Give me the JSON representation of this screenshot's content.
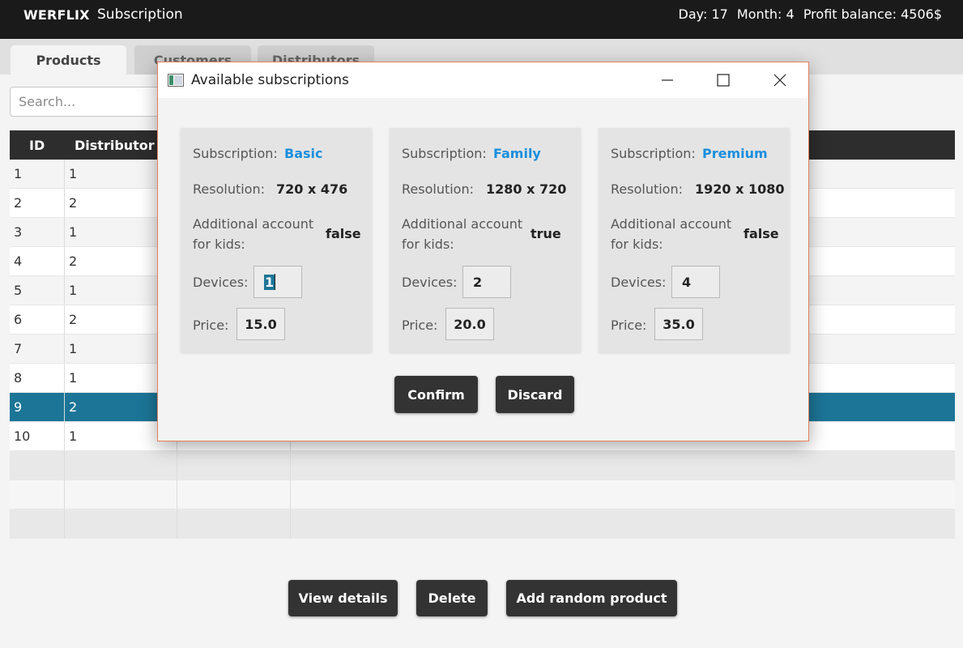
{
  "app": {
    "brand": "WERFLIX",
    "page": "Subscription",
    "stats": {
      "day": "Day: 17",
      "month": "Month: 4",
      "balance": "Profit balance: 4506$"
    }
  },
  "tabs": [
    "Products",
    "Customers",
    "Distributors"
  ],
  "search": {
    "placeholder": "Search...",
    "value": ""
  },
  "table": {
    "columns": [
      "ID",
      "Distributor I"
    ],
    "rows": [
      {
        "id": "1",
        "distributor": "1"
      },
      {
        "id": "2",
        "distributor": "2"
      },
      {
        "id": "3",
        "distributor": "1"
      },
      {
        "id": "4",
        "distributor": "2"
      },
      {
        "id": "5",
        "distributor": "1"
      },
      {
        "id": "6",
        "distributor": "2"
      },
      {
        "id": "7",
        "distributor": "1"
      },
      {
        "id": "8",
        "distributor": "1"
      },
      {
        "id": "9",
        "distributor": "2"
      },
      {
        "id": "10",
        "distributor": "1"
      }
    ],
    "selected_row": "9"
  },
  "buttons": {
    "view_details": "View details",
    "delete": "Delete",
    "add_random": "Add random product"
  },
  "dialog": {
    "title": "Available subscriptions",
    "labels": {
      "subscription": "Subscription:",
      "resolution": "Resolution:",
      "kids_line1": "Additional account",
      "kids_line2": "for kids:",
      "devices": "Devices:",
      "price": "Price:"
    },
    "plans": [
      {
        "name": "Basic",
        "resolution": "720 x 476",
        "kids": "false",
        "devices": "1",
        "price": "15.0"
      },
      {
        "name": "Family",
        "resolution": "1280 x 720",
        "kids": "true",
        "devices": "2",
        "price": "20.0"
      },
      {
        "name": "Premium",
        "resolution": "1920 x 1080",
        "kids": "false",
        "devices": "4",
        "price": "35.0"
      }
    ],
    "confirm": "Confirm",
    "discard": "Discard"
  },
  "colors": {
    "accent": "#1c7597",
    "plan_name": "#1a8fdd",
    "dark_button": "#333333",
    "header": "#1a1a1a"
  },
  "icons": {
    "minimize": "minimize-icon",
    "maximize": "maximize-icon",
    "close": "close-icon",
    "app": "app-window-icon"
  }
}
